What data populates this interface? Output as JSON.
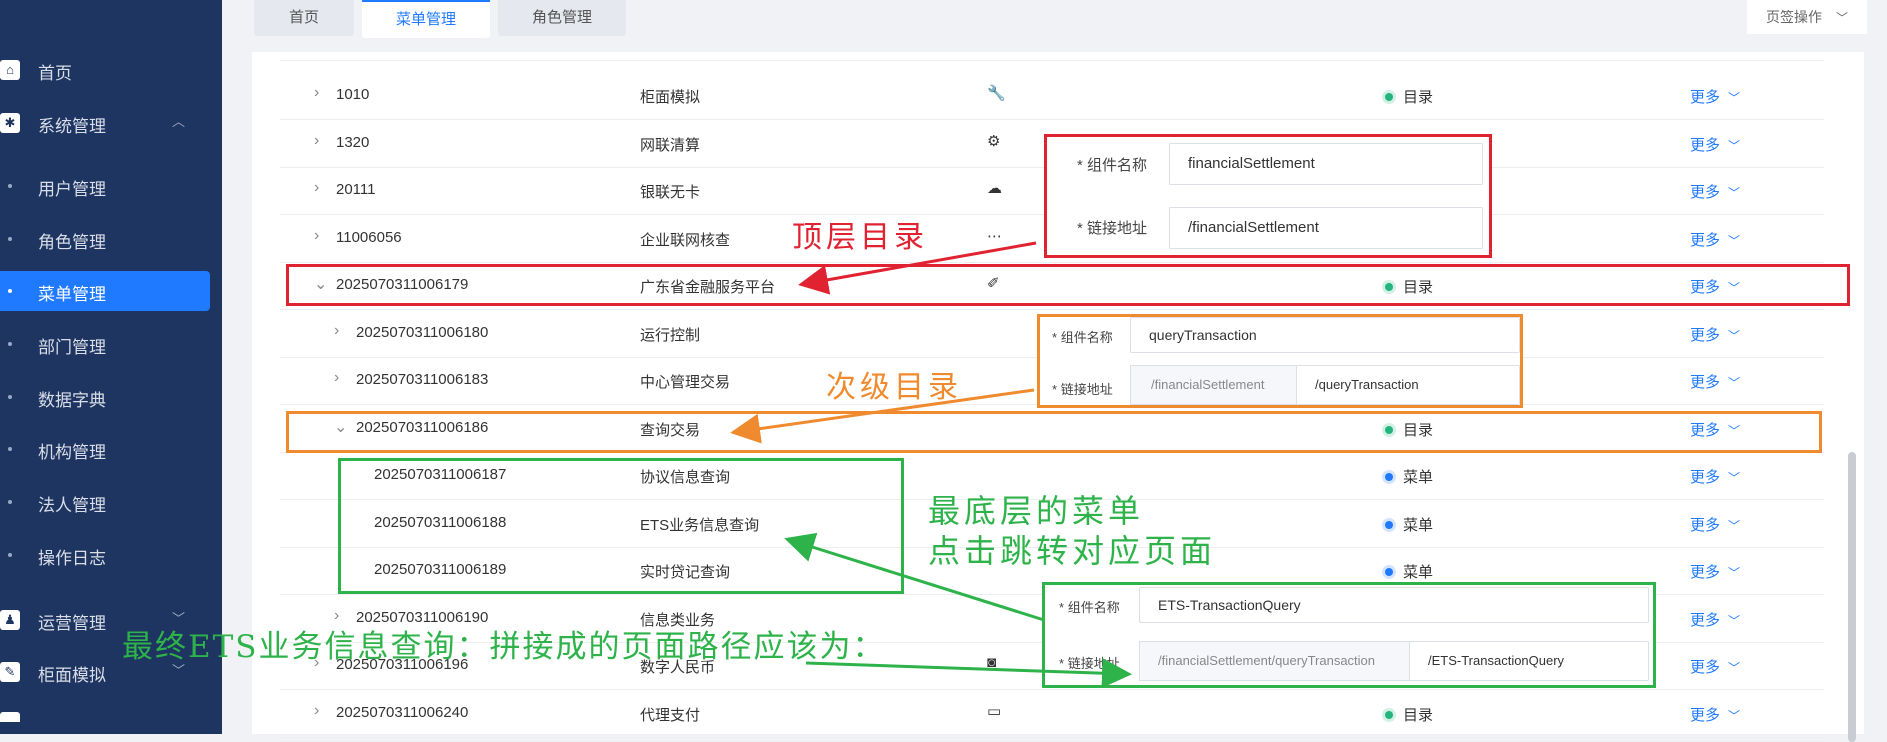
{
  "sidebar": {
    "items": [
      {
        "label": "首页",
        "icon": "home-icon",
        "glyph": "⌂"
      },
      {
        "label": "系统管理",
        "icon": "gear-icon",
        "glyph": "✱",
        "expand": "︿"
      },
      {
        "label": "用户管理"
      },
      {
        "label": "角色管理"
      },
      {
        "label": "菜单管理"
      },
      {
        "label": "部门管理"
      },
      {
        "label": "数据字典"
      },
      {
        "label": "机构管理"
      },
      {
        "label": "法人管理"
      },
      {
        "label": "操作日志"
      },
      {
        "label": "运营管理",
        "icon": "user-icon",
        "glyph": "♟",
        "expand": "﹀"
      },
      {
        "label": "柜面模拟",
        "icon": "wrench-icon",
        "glyph": "✎",
        "expand": "﹀"
      }
    ]
  },
  "tabs": [
    {
      "label": "首页"
    },
    {
      "label": "菜单管理"
    },
    {
      "label": "角色管理"
    }
  ],
  "page_ops": {
    "label": "页签操作",
    "chevron": "﹀"
  },
  "table": {
    "more_label": "更多",
    "more_chevron": "﹀",
    "rows": [
      {
        "id": "1010",
        "name": "柜面模拟",
        "icon": "wrench-icon",
        "glyph": "🔧",
        "type": "目录",
        "type_color": "#24b47e",
        "caret": "›"
      },
      {
        "id": "1320",
        "name": "网联清算",
        "icon": "network-icon",
        "glyph": "⚙",
        "type": "",
        "type_color": "",
        "caret": "›"
      },
      {
        "id": "20111",
        "name": "银联无卡",
        "icon": "cloud-icon",
        "glyph": "☁",
        "type": "",
        "type_color": "",
        "caret": "›"
      },
      {
        "id": "11006056",
        "name": "企业联网核查",
        "icon": "rss-icon",
        "glyph": "⋯",
        "type": "",
        "type_color": "",
        "caret": "›"
      },
      {
        "id": "2025070311006179",
        "name": "广东省金融服务平台",
        "icon": "brush-icon",
        "glyph": "✐",
        "type": "目录",
        "type_color": "#24b47e",
        "caret": "⌄"
      },
      {
        "id": "2025070311006180",
        "name": "运行控制",
        "icon": "",
        "glyph": "",
        "type": "",
        "type_color": "",
        "caret": "›"
      },
      {
        "id": "2025070311006183",
        "name": "中心管理交易",
        "icon": "",
        "glyph": "",
        "type": "",
        "type_color": "",
        "caret": "›"
      },
      {
        "id": "2025070311006186",
        "name": "查询交易",
        "icon": "",
        "glyph": "",
        "type": "目录",
        "type_color": "#24b47e",
        "caret": "⌄"
      },
      {
        "id": "2025070311006187",
        "name": "协议信息查询",
        "icon": "",
        "glyph": "",
        "type": "菜单",
        "type_color": "#1f7aff",
        "caret": ""
      },
      {
        "id": "2025070311006188",
        "name": "ETS业务信息查询",
        "icon": "",
        "glyph": "",
        "type": "菜单",
        "type_color": "#1f7aff",
        "caret": ""
      },
      {
        "id": "2025070311006189",
        "name": "实时贷记查询",
        "icon": "",
        "glyph": "",
        "type": "菜单",
        "type_color": "#1f7aff",
        "caret": ""
      },
      {
        "id": "2025070311006190",
        "name": "信息类业务",
        "icon": "",
        "glyph": "",
        "type": "",
        "type_color": "",
        "caret": "›"
      },
      {
        "id": "2025070311006196",
        "name": "数字人民币",
        "icon": "camera-icon",
        "glyph": "◙",
        "type": "",
        "type_color": "",
        "caret": "›"
      },
      {
        "id": "2025070311006240",
        "name": "代理支付",
        "icon": "monitor-icon",
        "glyph": "▭",
        "type": "目录",
        "type_color": "#24b47e",
        "caret": "›"
      }
    ]
  },
  "form_labels": {
    "component": "组件名称",
    "path": "链接地址",
    "required": "*"
  },
  "callout_top": {
    "component": "financialSettlement",
    "path": "/financialSettlement"
  },
  "callout_mid": {
    "component": "queryTransaction",
    "prefix": "/financialSettlement",
    "path": "/queryTransaction"
  },
  "callout_bottom": {
    "component": "ETS-TransactionQuery",
    "prefix": "/financialSettlement/queryTransaction",
    "path": "/ETS-TransactionQuery"
  },
  "notes": {
    "top_dir": "顶层目录",
    "sub_dir": "次级目录",
    "leaf_line1": "最底层的菜单",
    "leaf_line2": "点击跳转对应页面",
    "final": "最终ETS业务信息查询：拼接成的页面路径应该为："
  },
  "colors": {
    "red": "#e02231",
    "orange": "#f08a2e",
    "green": "#2db34a",
    "accent": "#1f7aff",
    "sidebar": "#1f3561"
  }
}
